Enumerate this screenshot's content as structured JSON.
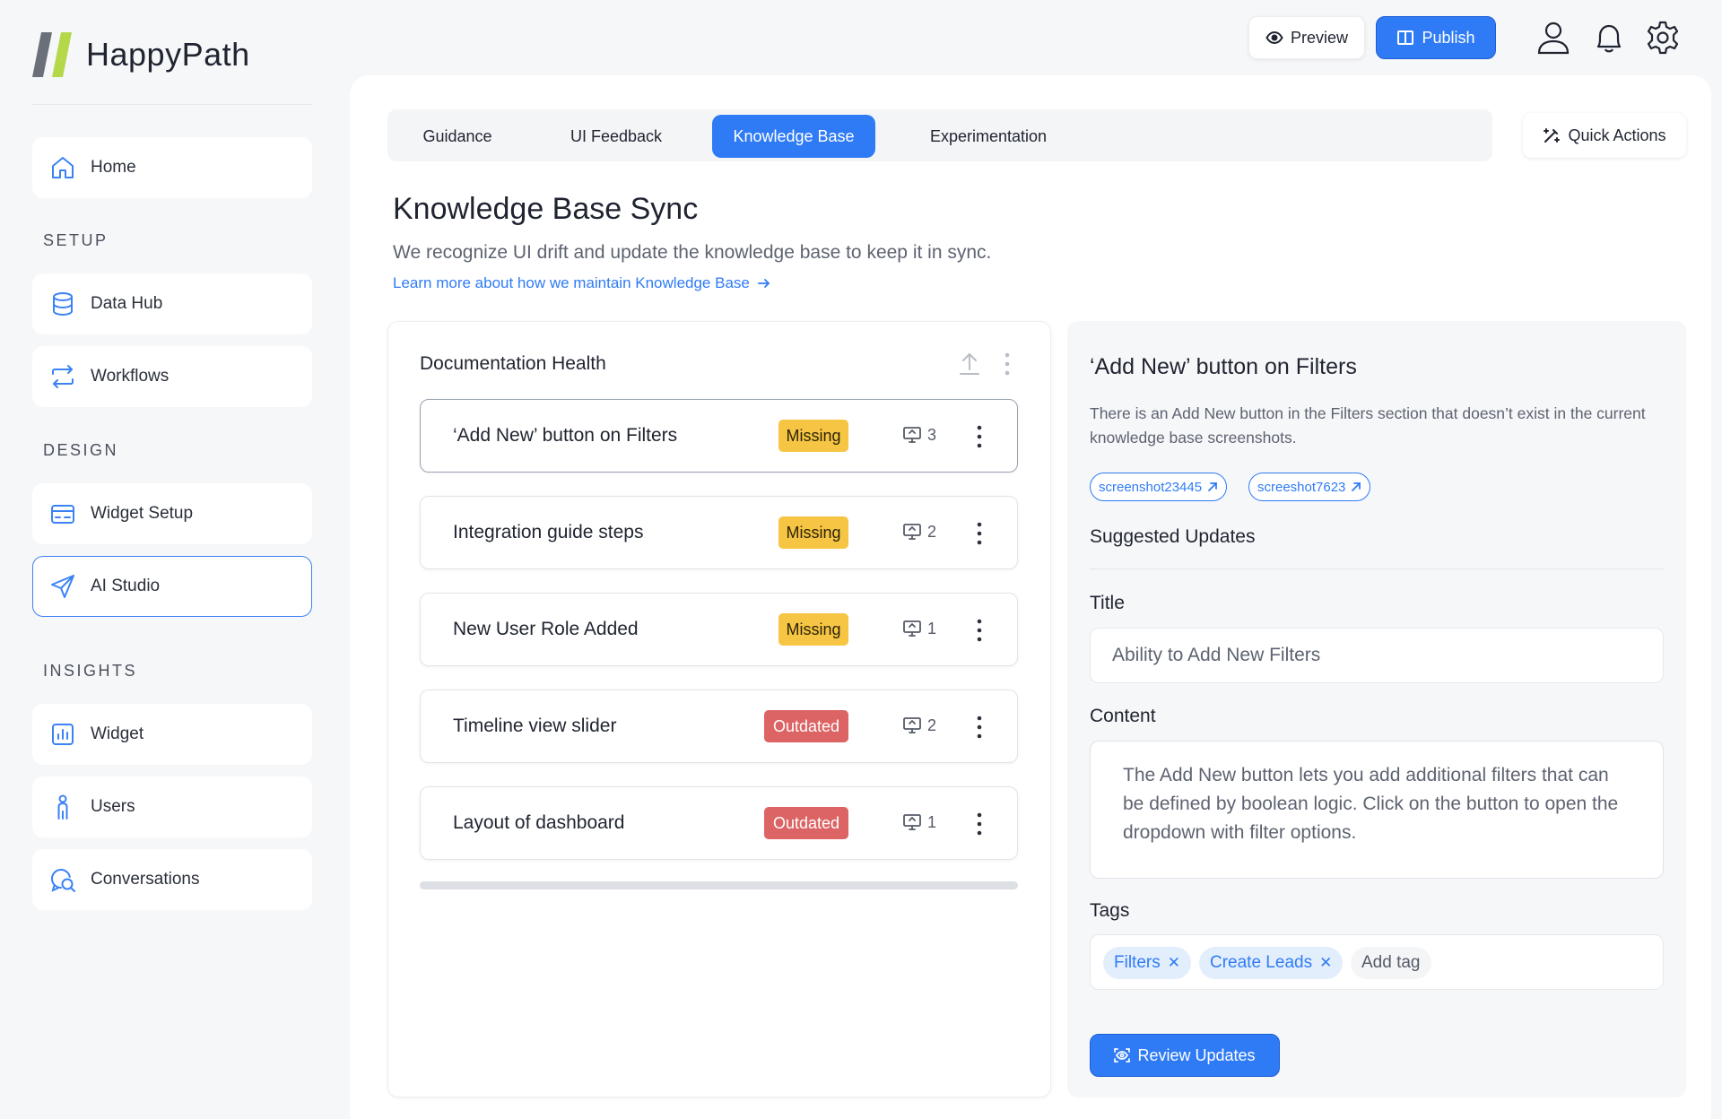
{
  "brand": {
    "name": "HappyPath",
    "colors": {
      "accent": "#2f7bf5",
      "missing": "#f6c543",
      "outdated": "#dc6464"
    }
  },
  "sidebar": {
    "home": "Home",
    "sections": {
      "setup": "SETUP",
      "design": "DESIGN",
      "insights": "INSIGHTS"
    },
    "items": [
      {
        "label": "Home",
        "icon": "home-icon"
      },
      {
        "label": "Data Hub",
        "icon": "database-icon"
      },
      {
        "label": "Workflows",
        "icon": "workflow-icon"
      },
      {
        "label": "Widget Setup",
        "icon": "widget-setup-icon"
      },
      {
        "label": "AI Studio",
        "icon": "send-icon",
        "active": true
      },
      {
        "label": "Widget",
        "icon": "chart-icon"
      },
      {
        "label": "Users",
        "icon": "user-icon"
      },
      {
        "label": "Conversations",
        "icon": "chat-search-icon"
      }
    ]
  },
  "topbar": {
    "preview_label": "Preview",
    "publish_label": "Publish"
  },
  "tabs": [
    {
      "label": "Guidance"
    },
    {
      "label": "UI Feedback"
    },
    {
      "label": "Knowledge Base",
      "active": true
    },
    {
      "label": "Experimentation"
    }
  ],
  "quick_actions_label": "Quick Actions",
  "page": {
    "title": "Knowledge Base Sync",
    "subtitle": "We recognize UI drift and update the knowledge base to keep it in sync.",
    "learn_link": "Learn more about how we maintain Knowledge Base"
  },
  "doc_health": {
    "title": "Documentation Health",
    "rows": [
      {
        "label": "‘Add New’ button on Filters",
        "status": "Missing",
        "count": "3",
        "selected": true
      },
      {
        "label": "Integration guide steps",
        "status": "Missing",
        "count": "2"
      },
      {
        "label": "New User Role Added",
        "status": "Missing",
        "count": "1"
      },
      {
        "label": "Timeline view slider",
        "status": "Outdated",
        "count": "2"
      },
      {
        "label": "Layout of dashboard",
        "status": "Outdated",
        "count": "1"
      }
    ]
  },
  "detail": {
    "title": "‘Add New’ button on Filters",
    "description": "There is an Add New button in the Filters section that doesn’t exist in the current knowledge base screenshots.",
    "screenshots": [
      "screenshot23445",
      "screeshot7623"
    ],
    "suggested_updates_label": "Suggested Updates",
    "title_label": "Title",
    "title_value": "Ability to Add New Filters",
    "content_label": "Content",
    "content_value": "The Add New button lets you add additional filters that can be defined by boolean logic. Click on the button to open the dropdown with filter options.",
    "tags_label": "Tags",
    "tags": [
      "Filters",
      "Create Leads"
    ],
    "add_tag_placeholder": "Add tag",
    "review_button": "Review Updates"
  }
}
